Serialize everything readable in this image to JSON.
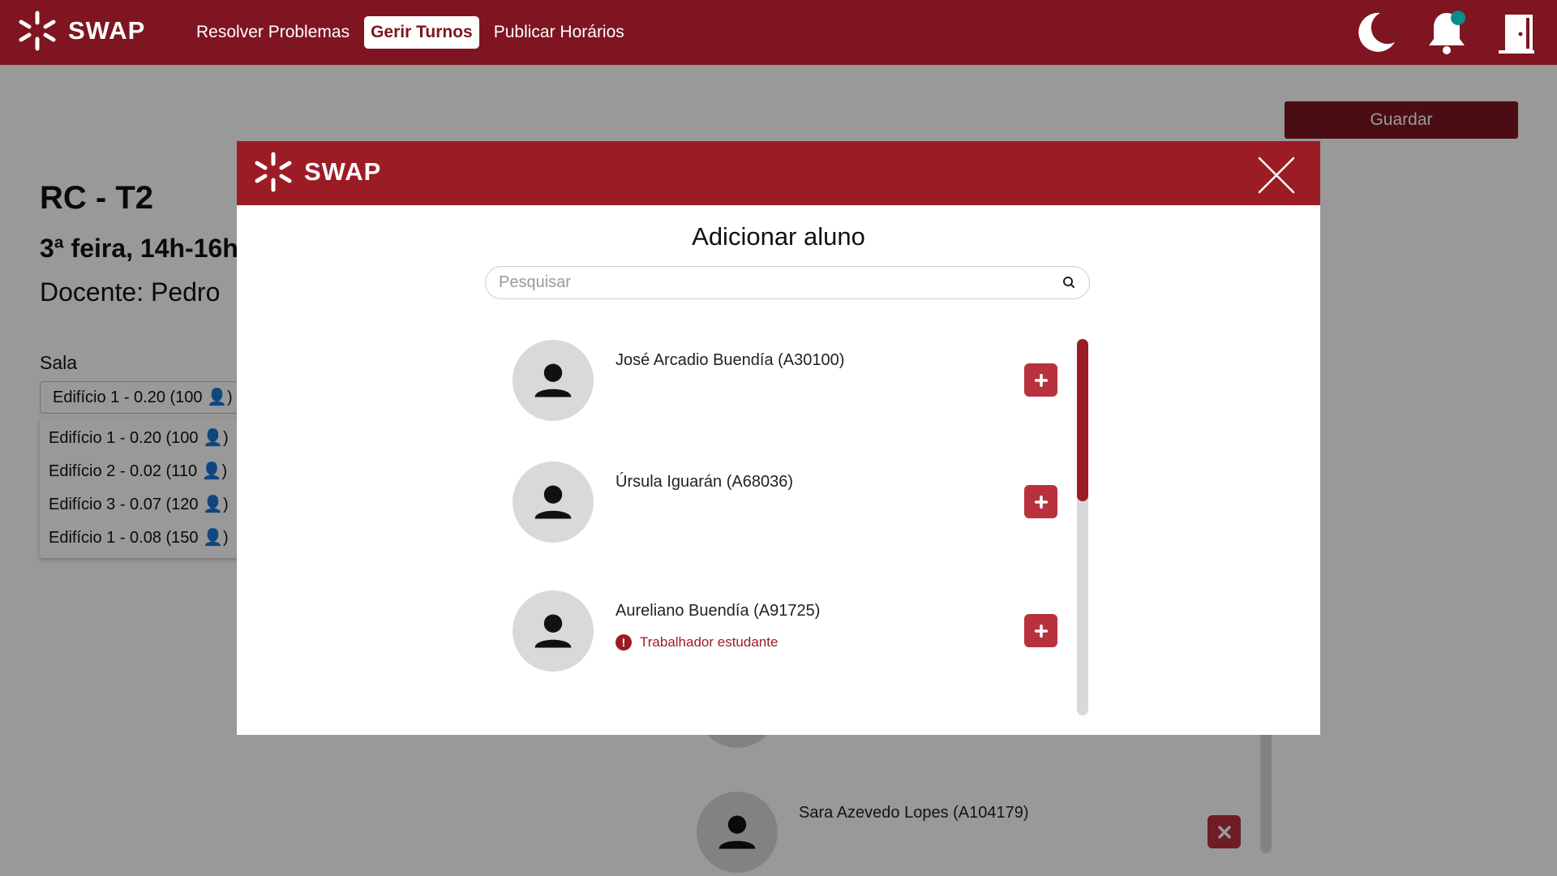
{
  "navbar": {
    "brand": "SWAP",
    "links": [
      {
        "label": "Resolver Problemas"
      },
      {
        "label": "Gerir Turnos"
      },
      {
        "label": "Publicar Horários"
      }
    ],
    "icons": [
      "moon-icon",
      "bell-icon",
      "exit-door-icon"
    ]
  },
  "page": {
    "save_label": "Guardar",
    "shift_title": "RC - T2",
    "shift_time": "3ª feira, 14h-16h",
    "teacher": "Docente: Pedro",
    "room_label": "Sala",
    "room_selected": "Edifício 1 - 0.20 (100 👤)",
    "room_options": [
      "Edifício 1 - 0.20 (100 👤)",
      "Edifício 2 - 0.02 (110 👤)",
      "Edifício 3 - 0.07 (120 👤)",
      "Edifício 1 - 0.08 (150 👤)"
    ],
    "enrolled_student": "Sara Azevedo Lopes (A104179)"
  },
  "modal": {
    "brand": "SWAP",
    "title": "Adicionar aluno",
    "search_placeholder": "Pesquisar",
    "students": [
      {
        "name": "José Arcadio Buendía (A30100)",
        "tag": ""
      },
      {
        "name": "Úrsula Iguarán (A68036)",
        "tag": ""
      },
      {
        "name": "Aureliano Buendía (A91725)",
        "tag": "Trabalhador estudante"
      }
    ],
    "scroll_fraction": 0.43
  },
  "colors": {
    "navbar": "#7e1520",
    "modal_header": "#9c1c26",
    "accent_button": "#b8313d",
    "notification_dot": "#0b8a8a"
  }
}
